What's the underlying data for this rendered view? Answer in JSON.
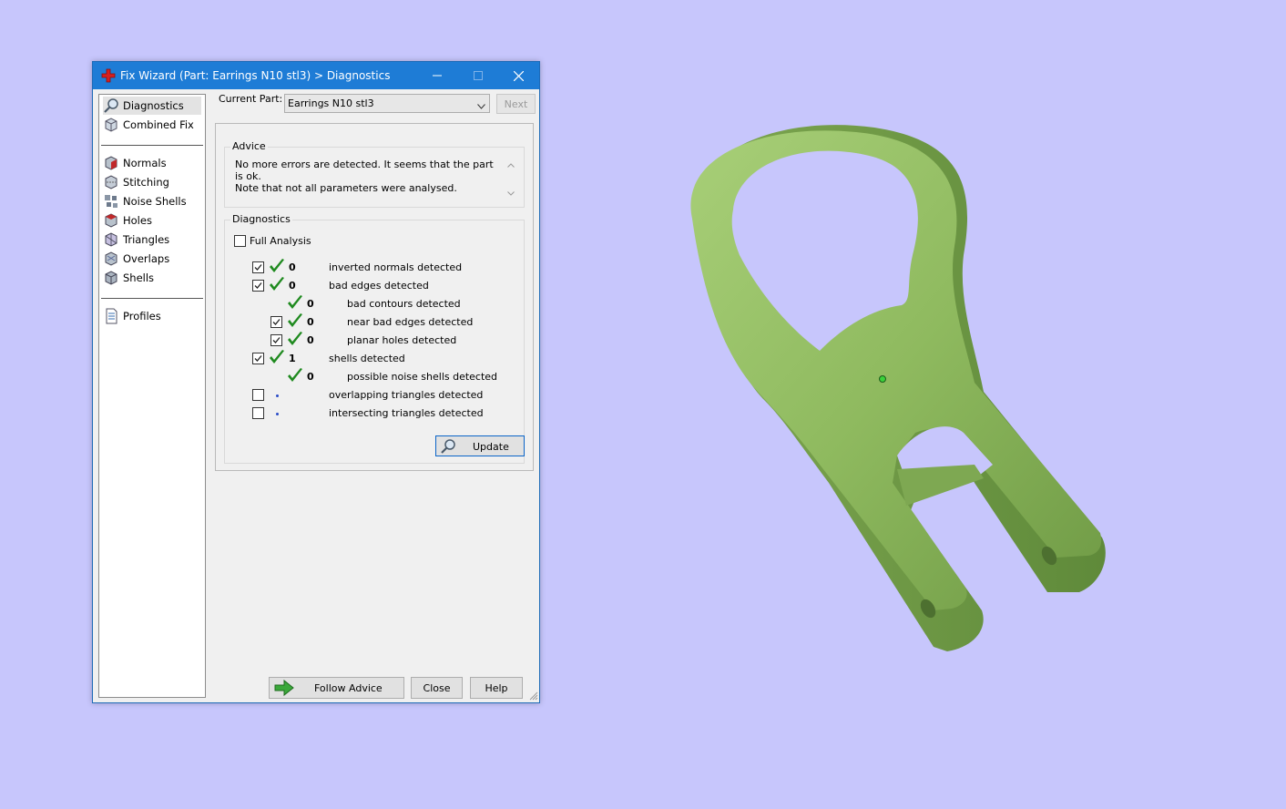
{
  "window": {
    "title": "Fix Wizard (Part: Earrings N10 stl3) > Diagnostics"
  },
  "nav": {
    "group1": [
      {
        "label": "Diagnostics",
        "icon": "magnifier-icon",
        "selected": true
      },
      {
        "label": "Combined Fix",
        "icon": "cube-icon"
      }
    ],
    "group2": [
      {
        "label": "Normals",
        "icon": "normals-icon"
      },
      {
        "label": "Stitching",
        "icon": "stitching-icon"
      },
      {
        "label": "Noise Shells",
        "icon": "noise-shells-icon"
      },
      {
        "label": "Holes",
        "icon": "holes-icon"
      },
      {
        "label": "Triangles",
        "icon": "triangles-icon"
      },
      {
        "label": "Overlaps",
        "icon": "overlaps-icon"
      },
      {
        "label": "Shells",
        "icon": "shells-icon"
      }
    ],
    "group3": [
      {
        "label": "Profiles",
        "icon": "document-icon"
      }
    ]
  },
  "current_part": {
    "label": "Current Part:",
    "value": "Earrings N10 stl3",
    "next_label": "Next"
  },
  "advice": {
    "title": "Advice",
    "line1": "No more errors are detected. It seems that the part is ok.",
    "line2": "Note that not all parameters were analysed."
  },
  "diagnostics": {
    "title": "Diagnostics",
    "full_analysis_label": "Full Analysis",
    "full_analysis_checked": false,
    "rows": [
      {
        "checkbox": true,
        "checked": true,
        "status": "ok",
        "count": "0",
        "label": "inverted normals detected",
        "indent": 0
      },
      {
        "checkbox": true,
        "checked": true,
        "status": "ok",
        "count": "0",
        "label": "bad edges detected",
        "indent": 0
      },
      {
        "checkbox": false,
        "checked": false,
        "status": "ok",
        "count": "0",
        "label": "bad contours detected",
        "indent": 1
      },
      {
        "checkbox": true,
        "checked": true,
        "status": "ok",
        "count": "0",
        "label": "near bad edges detected",
        "indent": 1
      },
      {
        "checkbox": true,
        "checked": true,
        "status": "ok",
        "count": "0",
        "label": "planar holes detected",
        "indent": 1
      },
      {
        "checkbox": true,
        "checked": true,
        "status": "ok",
        "count": "1",
        "label": "shells detected",
        "indent": 0
      },
      {
        "checkbox": false,
        "checked": false,
        "status": "ok",
        "count": "0",
        "label": "possible noise shells detected",
        "indent": 1
      },
      {
        "checkbox": true,
        "checked": false,
        "status": "pending",
        "count": "",
        "label": "overlapping triangles detected",
        "indent": 0
      },
      {
        "checkbox": true,
        "checked": false,
        "status": "pending",
        "count": "",
        "label": "intersecting triangles detected",
        "indent": 0
      }
    ],
    "update_label": "Update"
  },
  "buttons": {
    "follow_advice": "Follow Advice",
    "close": "Close",
    "help": "Help"
  },
  "colors": {
    "background": "#c7c6fc",
    "title_bar": "#1e7cd6",
    "model_green": "#8fba5f",
    "check_green": "#1f8a1f"
  }
}
